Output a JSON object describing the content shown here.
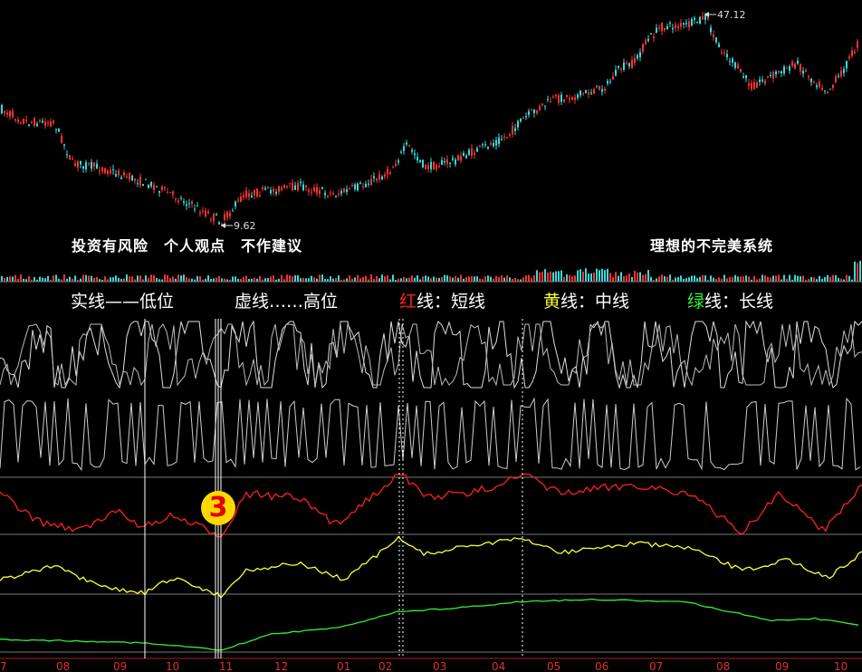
{
  "price_high_label": "47.12",
  "price_low_label": "9.62",
  "disclaimer": "投资有风险　个人观点　不作建议",
  "system_name": "理想的不完美系统",
  "legend": {
    "solid_text": "实线——低位",
    "dashed_text": "虚线……高位",
    "red_word": "红",
    "red_rest": "线：短线",
    "yellow_word": "黄",
    "yellow_rest": "线：中线",
    "green_word": "绿",
    "green_rest": "线：长线"
  },
  "badge_number": "3",
  "months": [
    "7",
    "08",
    "09",
    "10",
    "11",
    "12",
    "01",
    "02",
    "03",
    "04",
    "05",
    "06",
    "07",
    "08",
    "09",
    "10"
  ],
  "colors": {
    "background": "#000000",
    "candle_up": "#ff3333",
    "candle_down": "#33dddd",
    "short_line": "#ff2020",
    "mid_line": "#ffff33",
    "long_line": "#33ee33",
    "osc_line": "#ffffff",
    "badge_fill": "#ffd800",
    "badge_text": "#e00000",
    "month_label": "#e03030"
  }
}
